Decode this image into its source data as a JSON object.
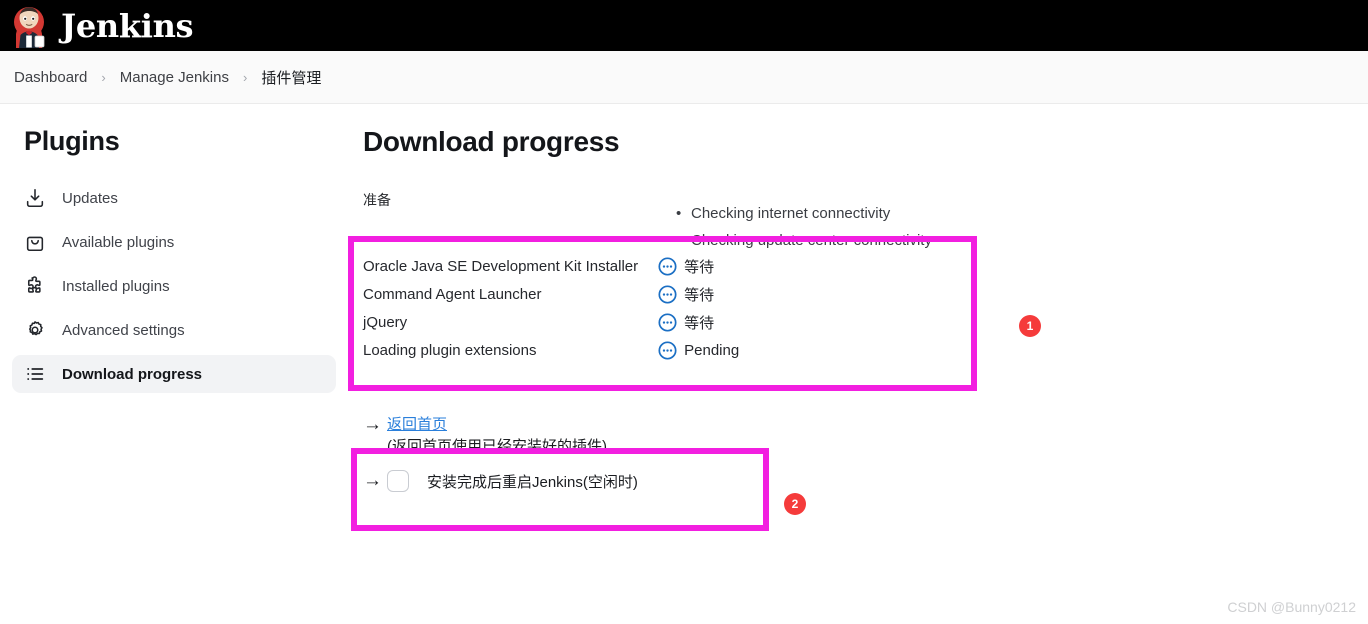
{
  "header": {
    "brand": "Jenkins",
    "logo_icon": "jenkins-butler-logo"
  },
  "breadcrumb": {
    "items": [
      {
        "label": "Dashboard"
      },
      {
        "label": "Manage Jenkins"
      },
      {
        "label": "插件管理"
      }
    ],
    "separator": "›"
  },
  "sidebar": {
    "heading": "Plugins",
    "items": [
      {
        "label": "Updates",
        "icon": "download-icon",
        "active": false
      },
      {
        "label": "Available plugins",
        "icon": "shopping-bag-icon",
        "active": false
      },
      {
        "label": "Installed plugins",
        "icon": "puzzle-piece-icon",
        "active": false
      },
      {
        "label": "Advanced settings",
        "icon": "gear-icon",
        "active": false
      },
      {
        "label": "Download progress",
        "icon": "list-icon",
        "active": true
      }
    ]
  },
  "main": {
    "page_title": "Download progress",
    "prepare_label": "准备",
    "status_checks": [
      "Checking internet connectivity",
      "Checking update center connectivity"
    ],
    "plugin_table": {
      "rows": [
        {
          "name": "Oracle Java SE Development Kit Installer",
          "status": "等待",
          "status_icon": "pending-dots-icon"
        },
        {
          "name": "Command Agent Launcher",
          "status": "等待",
          "status_icon": "pending-dots-icon"
        },
        {
          "name": "jQuery",
          "status": "等待",
          "status_icon": "pending-dots-icon"
        },
        {
          "name": "Loading plugin extensions",
          "status": "Pending",
          "status_icon": "pending-dots-icon"
        }
      ]
    },
    "actions": {
      "arrow_glyph": "→",
      "home_link": "返回首页",
      "home_link_sub": "(返回首页使用已经安装好的插件)",
      "restart_label": "安装完成后重启Jenkins(空闲时)",
      "restart_checked": false
    }
  },
  "annotations": {
    "color": "#f21fe0",
    "badge_color": "#f53b3b",
    "badges": [
      {
        "label": "1"
      },
      {
        "label": "2"
      }
    ]
  },
  "watermark": {
    "text": "CSDN @Bunny0212"
  }
}
